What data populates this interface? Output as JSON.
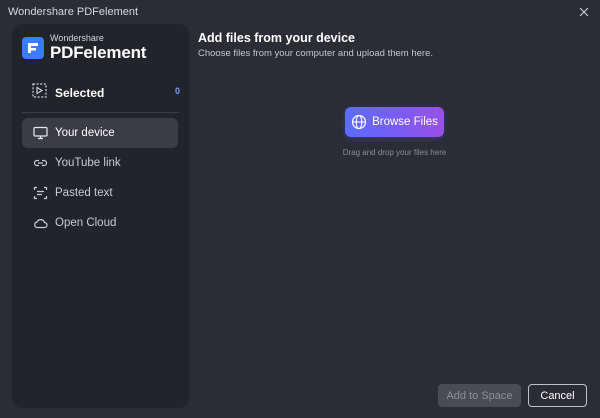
{
  "window": {
    "title": "Wondershare PDFelement"
  },
  "brand": {
    "small": "Wondershare",
    "big": "PDFelement"
  },
  "selected": {
    "label": "Selected",
    "count": "0"
  },
  "nav": {
    "items": [
      {
        "label": "Your device",
        "icon": "monitor-icon",
        "active": true
      },
      {
        "label": "YouTube link",
        "icon": "link-icon",
        "active": false
      },
      {
        "label": "Pasted text",
        "icon": "text-scan-icon",
        "active": false
      },
      {
        "label": "Open Cloud",
        "icon": "cloud-icon",
        "active": false
      }
    ]
  },
  "main": {
    "title": "Add files from your device",
    "subtitle": "Choose files from your computer and upload them here.",
    "browse_label": "Browse Files",
    "drag_hint": "Drag and drop your files here"
  },
  "footer": {
    "add_label": "Add to Space",
    "cancel_label": "Cancel"
  },
  "colors": {
    "background": "#2b2c36",
    "sidebar": "#22232b",
    "accent": "#3b7cff",
    "gradient_start": "#5b6cff",
    "gradient_end": "#9a4fe6"
  }
}
